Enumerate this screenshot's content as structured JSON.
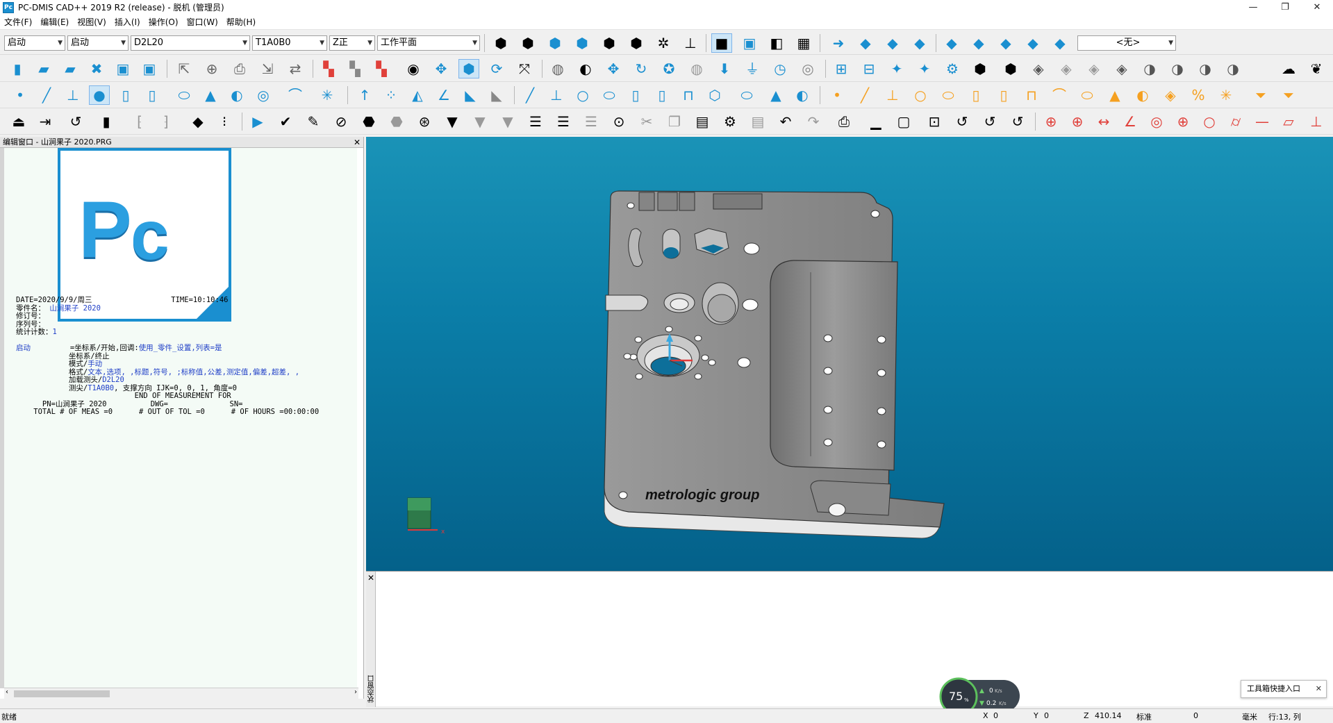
{
  "window": {
    "title": "PC-DMIS CAD++ 2019 R2 (release) - 脱机 (管理员)",
    "icon_text": "Pc"
  },
  "menu": [
    "文件(F)",
    "编辑(E)",
    "视图(V)",
    "插入(I)",
    "操作(O)",
    "窗口(W)",
    "帮助(H)"
  ],
  "combos": {
    "alignment": "启动",
    "view_alignment": "启动",
    "probe": "D2L20",
    "tip": "T1A0B0",
    "plane": "Z正",
    "workplane": "工作平面",
    "none": "<无>"
  },
  "editor": {
    "title": "编辑窗口 - 山涧果子 2020.PRG",
    "logo_text": "Pc",
    "lines": [
      {
        "k": "",
        "t": "DATE=2020/9/9/周三                  TIME=10:10:46"
      },
      {
        "k": "",
        "t": "零件名： ",
        "b": "山涧果子 2020"
      },
      {
        "k": "",
        "t": "修订号："
      },
      {
        "k": "",
        "t": "序列号："
      },
      {
        "k": "",
        "t": "统计计数：",
        "b": "1"
      },
      {
        "k": "",
        "t": ""
      },
      {
        "k": "启动",
        "t": "         =坐标系/开始,回调:",
        "b": "使用_零件_设置,列表=是"
      },
      {
        "k": "",
        "t": "            坐标系/终止"
      },
      {
        "k": "",
        "t": "            模式/",
        "b": "手动"
      },
      {
        "k": "",
        "t": "            格式/",
        "b": "文本,选项, ,标题,符号, ;标称值,公差,测定值,偏差,超差, ,"
      },
      {
        "k": "",
        "t": "            加载测头/",
        "b": "D2L20"
      },
      {
        "k": "",
        "t": "            测尖/",
        "b": "T1A0B0",
        "c": ", 支撑方向 IJK=0, 0, 1, 角度=0"
      },
      {
        "k": "",
        "t": "                           END OF MEASUREMENT FOR"
      },
      {
        "k": "",
        "t": "      PN=山涧果子 2020          DWG=              SN="
      },
      {
        "k": "",
        "t": "    TOTAL # OF MEAS =0      # OUT OF TOL =0      # OF HOURS =00:00:00"
      }
    ]
  },
  "viewport": {
    "part_label": "metrologic group"
  },
  "bottom_pane": {
    "tab_label": "状态窗口"
  },
  "status": {
    "ready": "就绪",
    "x_label": "X",
    "x_val": "0",
    "y_label": "Y",
    "y_val": "0",
    "z_label": "Z",
    "z_val": "410.14",
    "mode": "标准",
    "val": "0",
    "unit": "毫米",
    "pos": "行:13, 列"
  },
  "speed": {
    "percent": "75",
    "unit": "%",
    "up": "0",
    "down": "0.2",
    "rate_unit": "K/s"
  },
  "toast": {
    "label": "工具箱快捷入口"
  },
  "colors": {
    "toolbar_blue": "#1a8fd0",
    "toolbar_orange": "#f5a020",
    "viewport_top": "#1a93b7",
    "viewport_bottom": "#04618a",
    "code_keyword": "#1f3fc7"
  }
}
